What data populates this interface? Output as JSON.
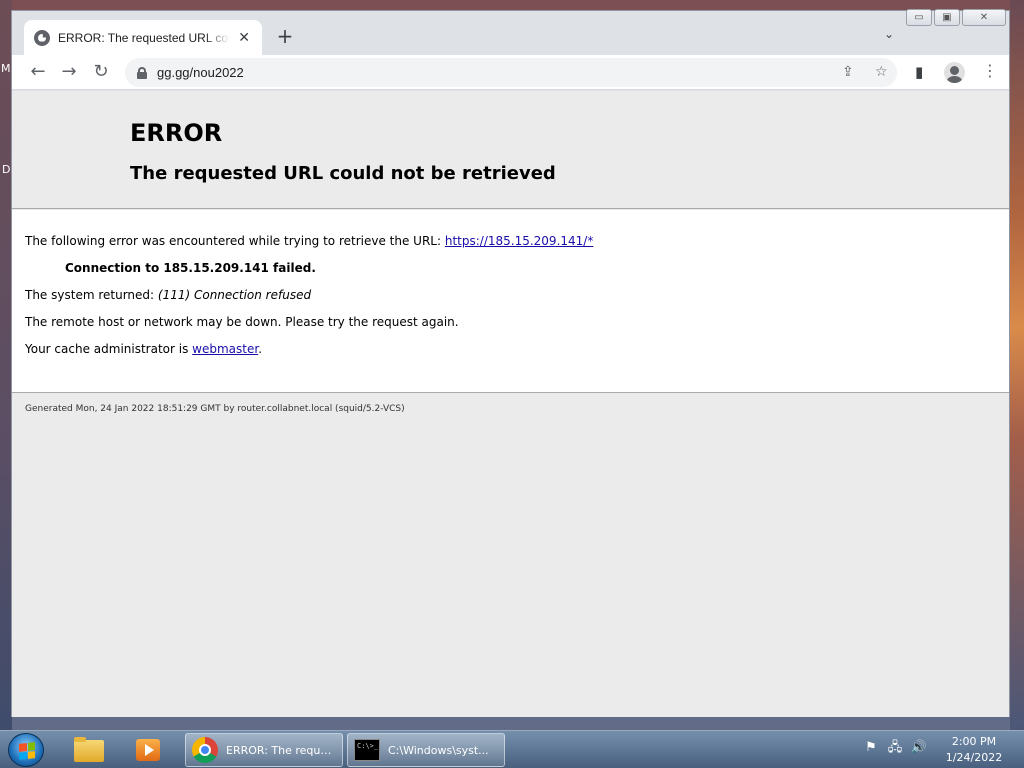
{
  "desktop": {
    "edge_label_top": "M",
    "edge_label_mid": "D"
  },
  "browser": {
    "tab": {
      "title": "ERROR: The requested URL could not be retrieved",
      "close_glyph": "✕"
    },
    "new_tab_glyph": "+",
    "tab_search_glyph": "⌄",
    "window_controls": {
      "minimize": "▭",
      "maximize": "▣",
      "close": "✕"
    },
    "nav": {
      "back": "←",
      "forward": "→",
      "reload": "↻"
    },
    "address_bar": {
      "url": "gg.gg/nou2022"
    },
    "toolbar_icons": {
      "share": "⇪",
      "bookmark": "☆",
      "side_panel": "▮",
      "menu": "⋮"
    }
  },
  "page": {
    "title": "ERROR",
    "subtitle": "The requested URL could not be retrieved",
    "line1_prefix": "The following error was encountered while trying to retrieve the URL: ",
    "line1_link": "https://185.15.209.141/*",
    "line2": "Connection to 185.15.209.141 failed.",
    "line3_prefix": "The system returned: ",
    "line3_italic": "(111) Connection refused",
    "line4": "The remote host or network may be down. Please try the request again.",
    "line5_prefix": "Your cache administrator is ",
    "line5_link": "webmaster",
    "line5_suffix": ".",
    "footer": "Generated Mon, 24 Jan 2022 18:51:29 GMT by router.collabnet.local (squid/5.2-VCS)"
  },
  "taskbar": {
    "task_chrome_label": "ERROR: The reque...",
    "task_cmd_label": "C:\\Windows\\syst...",
    "cmd_icon_text": "C:\\>_",
    "tray": {
      "flag": "⚑",
      "network": "🖧",
      "volume": "🔊"
    },
    "clock_time": "2:00 PM",
    "clock_date": "1/24/2022"
  }
}
